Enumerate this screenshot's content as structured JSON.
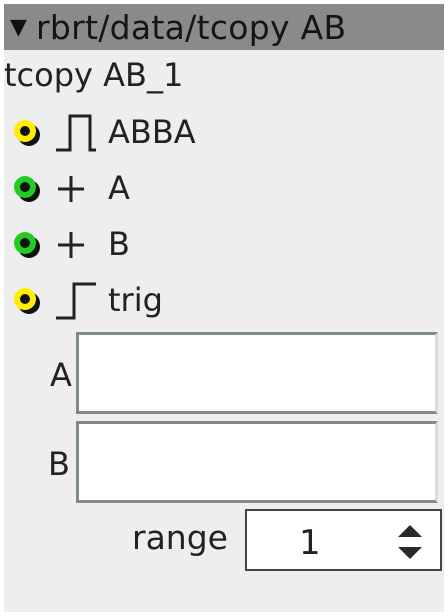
{
  "header": {
    "title": "rbrt/data/tcopy AB",
    "collapse_icon": "triangle-down-icon"
  },
  "node": {
    "name": "tcopy AB_1"
  },
  "ports": [
    {
      "label": "ABBA",
      "led_color": "#ffee00",
      "symbol": "pulse-icon"
    },
    {
      "label": "A",
      "led_color": "#22cc22",
      "symbol": "plus-icon"
    },
    {
      "label": "B",
      "led_color": "#22cc22",
      "symbol": "plus-icon"
    },
    {
      "label": "trig",
      "led_color": "#ffee00",
      "symbol": "step-icon"
    }
  ],
  "fields": [
    {
      "label": "A",
      "value": ""
    },
    {
      "label": "B",
      "value": ""
    }
  ],
  "range": {
    "label": "range",
    "value": "1"
  }
}
